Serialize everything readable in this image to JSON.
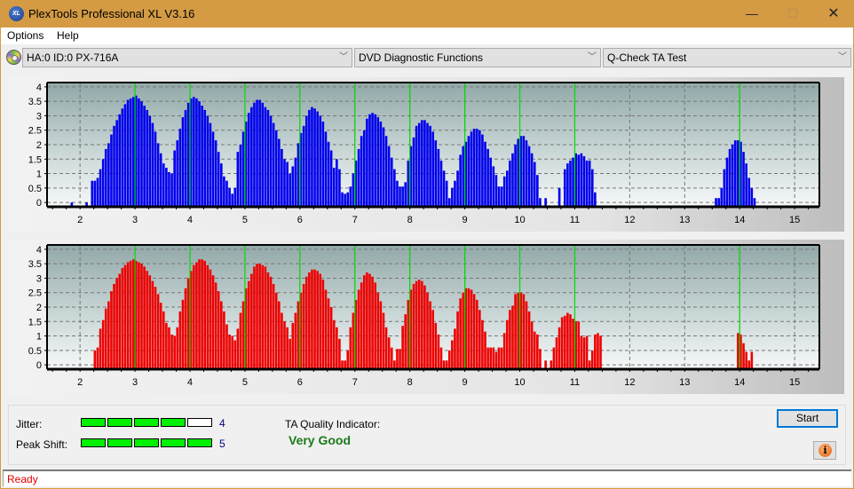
{
  "window": {
    "title": "PlexTools Professional XL V3.16",
    "app_icon_text": "XL",
    "minimize": "—",
    "maximize": "☐",
    "close": "✕"
  },
  "menu": [
    "Options",
    "Help"
  ],
  "toolbar": {
    "drive": "HA:0 ID:0  PX-716A",
    "function": "DVD Diagnostic Functions",
    "test": "Q-Check TA Test",
    "arrow": "﹀"
  },
  "colors": {
    "top_bars": "#0000ee",
    "bottom_bars": "#ee0000",
    "marker_lines": "#00dd00",
    "meter_on": "#00f000",
    "quality_text": "#1a7a1a",
    "status_text": "#e00000"
  },
  "chart_data": [
    {
      "type": "bar",
      "name": "TA distribution (blue)",
      "xlim": [
        1.4,
        15.45
      ],
      "ylim": [
        -0.15,
        4.15
      ],
      "xticks": [
        2,
        3,
        4,
        5,
        6,
        7,
        8,
        9,
        10,
        11,
        12,
        13,
        14,
        15
      ],
      "yticks": [
        0,
        0.5,
        1,
        1.5,
        2,
        2.5,
        3,
        3.5,
        4
      ],
      "ytick_labels": [
        "0",
        "0.5",
        "1",
        "1.5",
        "2",
        "2.5",
        "3",
        "3.5",
        "4"
      ],
      "markers": [
        3,
        4,
        5,
        6,
        7,
        8,
        9,
        10,
        11,
        14
      ],
      "grid": true,
      "bars": {
        "x": [
          1.85,
          2.12,
          2.22,
          2.27,
          2.32,
          2.37,
          2.42,
          2.47,
          2.52,
          2.57,
          2.62,
          2.67,
          2.72,
          2.77,
          2.82,
          2.87,
          2.92,
          2.97,
          3.02,
          3.07,
          3.12,
          3.17,
          3.22,
          3.27,
          3.32,
          3.37,
          3.42,
          3.47,
          3.52,
          3.57,
          3.62,
          3.67,
          3.72,
          3.77,
          3.82,
          3.87,
          3.92,
          3.97,
          4.02,
          4.07,
          4.12,
          4.17,
          4.22,
          4.27,
          4.32,
          4.37,
          4.42,
          4.47,
          4.52,
          4.57,
          4.62,
          4.67,
          4.72,
          4.77,
          4.82,
          4.87,
          4.92,
          4.97,
          5.02,
          5.07,
          5.12,
          5.17,
          5.22,
          5.27,
          5.32,
          5.37,
          5.42,
          5.47,
          5.52,
          5.57,
          5.62,
          5.67,
          5.72,
          5.77,
          5.82,
          5.87,
          5.92,
          5.97,
          6.02,
          6.07,
          6.12,
          6.17,
          6.22,
          6.27,
          6.32,
          6.37,
          6.42,
          6.47,
          6.52,
          6.57,
          6.62,
          6.67,
          6.72,
          6.77,
          6.82,
          6.87,
          6.92,
          6.97,
          7.02,
          7.07,
          7.12,
          7.17,
          7.22,
          7.27,
          7.32,
          7.37,
          7.42,
          7.47,
          7.52,
          7.57,
          7.62,
          7.67,
          7.72,
          7.77,
          7.82,
          7.87,
          7.92,
          7.97,
          8.02,
          8.07,
          8.12,
          8.17,
          8.22,
          8.27,
          8.32,
          8.37,
          8.42,
          8.47,
          8.52,
          8.57,
          8.62,
          8.67,
          8.72,
          8.77,
          8.82,
          8.87,
          8.92,
          8.97,
          9.02,
          9.07,
          9.12,
          9.17,
          9.22,
          9.27,
          9.32,
          9.37,
          9.42,
          9.47,
          9.52,
          9.57,
          9.62,
          9.67,
          9.72,
          9.77,
          9.82,
          9.87,
          9.92,
          9.97,
          10.02,
          10.07,
          10.12,
          10.17,
          10.22,
          10.27,
          10.32,
          10.37,
          10.47,
          10.72,
          10.82,
          10.87,
          10.92,
          10.97,
          11.02,
          11.07,
          11.12,
          11.17,
          11.22,
          11.27,
          11.32,
          11.37,
          13.57,
          13.62,
          13.67,
          13.72,
          13.77,
          13.82,
          13.87,
          13.92,
          13.97,
          14.02,
          14.07,
          14.12,
          14.17,
          14.22,
          14.27
        ],
        "values": [
          0,
          0,
          0.75,
          0.75,
          0.85,
          1.15,
          1.5,
          1.85,
          2.05,
          2.35,
          2.65,
          2.85,
          3.05,
          3.25,
          3.4,
          3.55,
          3.6,
          3.65,
          3.7,
          3.6,
          3.5,
          3.35,
          3.2,
          3.0,
          2.75,
          2.45,
          2.05,
          1.7,
          1.35,
          1.2,
          1.05,
          1.0,
          1.8,
          2.15,
          2.55,
          2.95,
          3.2,
          3.45,
          3.6,
          3.65,
          3.6,
          3.5,
          3.35,
          3.2,
          3.0,
          2.75,
          2.45,
          2.15,
          1.75,
          1.35,
          0.9,
          0.75,
          0.5,
          0.3,
          0.5,
          1.75,
          2.0,
          2.45,
          2.8,
          3.1,
          3.3,
          3.45,
          3.55,
          3.55,
          3.45,
          3.3,
          3.2,
          3.0,
          2.75,
          2.5,
          2.2,
          1.85,
          1.5,
          1.4,
          1.0,
          1.25,
          1.55,
          2.05,
          2.4,
          2.65,
          3.0,
          3.2,
          3.3,
          3.25,
          3.15,
          3.0,
          2.8,
          2.45,
          2.1,
          1.8,
          1.2,
          1.5,
          1.15,
          0.35,
          0.3,
          0.35,
          0.55,
          1.0,
          1.45,
          1.85,
          2.3,
          2.5,
          2.9,
          3.05,
          3.1,
          3.05,
          2.95,
          2.8,
          2.6,
          2.3,
          1.95,
          1.55,
          1.15,
          0.75,
          0.55,
          0.55,
          0.7,
          1.45,
          1.95,
          2.25,
          2.65,
          2.75,
          2.85,
          2.85,
          2.75,
          2.65,
          2.45,
          2.15,
          1.85,
          1.45,
          1.1,
          0.75,
          0.15,
          0.5,
          0.75,
          1.1,
          1.65,
          1.95,
          2.1,
          2.3,
          2.45,
          2.55,
          2.55,
          2.5,
          2.35,
          2.1,
          1.85,
          1.55,
          1.25,
          0.95,
          0.55,
          0.55,
          0.9,
          1.1,
          1.45,
          1.7,
          2.0,
          2.2,
          2.3,
          2.3,
          2.15,
          1.95,
          1.7,
          1.4,
          0.95,
          0.15,
          0.15,
          0.5,
          1.15,
          1.35,
          1.45,
          1.55,
          1.7,
          1.65,
          1.7,
          1.6,
          1.45,
          1.45,
          1.15,
          0.35,
          0.15,
          0.15,
          0.5,
          1.15,
          1.55,
          1.85,
          2.0,
          2.15,
          2.15,
          2.1,
          1.75,
          1.35,
          0.85,
          0.5,
          0.15
        ],
        "color": "#0000ee"
      }
    },
    {
      "type": "bar",
      "name": "TA distribution (red)",
      "xlim": [
        1.4,
        15.45
      ],
      "ylim": [
        -0.15,
        4.15
      ],
      "xticks": [
        2,
        3,
        4,
        5,
        6,
        7,
        8,
        9,
        10,
        11,
        12,
        13,
        14,
        15
      ],
      "yticks": [
        0,
        0.5,
        1,
        1.5,
        2,
        2.5,
        3,
        3.5,
        4
      ],
      "ytick_labels": [
        "0",
        "0.5",
        "1",
        "1.5",
        "2",
        "2.5",
        "3",
        "3.5",
        "4"
      ],
      "markers": [
        3,
        4,
        5,
        6,
        7,
        8,
        9,
        10,
        11,
        14
      ],
      "grid": true,
      "bars": {
        "x": [
          2.27,
          2.32,
          2.37,
          2.42,
          2.47,
          2.52,
          2.57,
          2.62,
          2.67,
          2.72,
          2.77,
          2.82,
          2.87,
          2.92,
          2.97,
          3.02,
          3.07,
          3.12,
          3.17,
          3.22,
          3.27,
          3.32,
          3.37,
          3.42,
          3.47,
          3.52,
          3.57,
          3.62,
          3.67,
          3.72,
          3.77,
          3.82,
          3.87,
          3.92,
          3.97,
          4.02,
          4.07,
          4.12,
          4.17,
          4.22,
          4.27,
          4.32,
          4.37,
          4.42,
          4.47,
          4.52,
          4.57,
          4.62,
          4.67,
          4.72,
          4.77,
          4.82,
          4.87,
          4.92,
          4.97,
          5.02,
          5.07,
          5.12,
          5.17,
          5.22,
          5.27,
          5.32,
          5.37,
          5.42,
          5.47,
          5.52,
          5.57,
          5.62,
          5.67,
          5.72,
          5.77,
          5.82,
          5.87,
          5.92,
          5.97,
          6.02,
          6.07,
          6.12,
          6.17,
          6.22,
          6.27,
          6.32,
          6.37,
          6.42,
          6.47,
          6.52,
          6.57,
          6.62,
          6.67,
          6.72,
          6.77,
          6.82,
          6.87,
          6.92,
          6.97,
          7.02,
          7.07,
          7.12,
          7.17,
          7.22,
          7.27,
          7.32,
          7.37,
          7.42,
          7.47,
          7.52,
          7.57,
          7.62,
          7.67,
          7.72,
          7.77,
          7.82,
          7.87,
          7.92,
          7.97,
          8.02,
          8.07,
          8.12,
          8.17,
          8.22,
          8.27,
          8.32,
          8.37,
          8.42,
          8.47,
          8.52,
          8.57,
          8.62,
          8.67,
          8.72,
          8.77,
          8.82,
          8.87,
          8.92,
          8.97,
          9.02,
          9.07,
          9.12,
          9.17,
          9.22,
          9.27,
          9.32,
          9.37,
          9.42,
          9.47,
          9.52,
          9.57,
          9.62,
          9.67,
          9.72,
          9.77,
          9.82,
          9.87,
          9.92,
          9.97,
          10.02,
          10.07,
          10.12,
          10.17,
          10.22,
          10.27,
          10.32,
          10.37,
          10.47,
          10.57,
          10.62,
          10.67,
          10.72,
          10.77,
          10.82,
          10.87,
          10.92,
          10.97,
          11.02,
          11.07,
          11.12,
          11.17,
          11.22,
          11.27,
          11.32,
          11.37,
          11.42,
          11.47,
          13.97,
          14.02,
          14.07,
          14.12,
          14.17,
          14.22,
          14.27,
          14.32,
          14.37,
          14.42,
          14.47
        ],
        "values": [
          0.5,
          0.6,
          1.25,
          1.55,
          1.95,
          2.2,
          2.55,
          2.8,
          3.0,
          3.15,
          3.35,
          3.45,
          3.55,
          3.6,
          3.65,
          3.6,
          3.55,
          3.5,
          3.4,
          3.25,
          3.1,
          2.9,
          2.7,
          2.45,
          2.15,
          1.85,
          1.45,
          1.3,
          1.05,
          1.0,
          1.3,
          1.85,
          2.25,
          2.65,
          3.0,
          3.25,
          3.45,
          3.55,
          3.65,
          3.65,
          3.6,
          3.45,
          3.3,
          3.1,
          2.85,
          2.55,
          2.2,
          1.85,
          1.4,
          1.05,
          1.0,
          0.85,
          1.25,
          1.8,
          2.2,
          2.65,
          2.9,
          3.15,
          3.4,
          3.5,
          3.5,
          3.45,
          3.4,
          3.2,
          3.05,
          2.8,
          2.5,
          2.2,
          1.8,
          1.5,
          1.3,
          0.9,
          1.45,
          1.8,
          2.2,
          2.5,
          2.8,
          3.05,
          3.2,
          3.3,
          3.3,
          3.25,
          3.15,
          2.95,
          2.6,
          2.3,
          2.0,
          1.55,
          1.3,
          0.9,
          0.15,
          0.15,
          0.5,
          1.3,
          1.8,
          2.25,
          2.6,
          2.85,
          3.1,
          3.2,
          3.15,
          3.05,
          2.85,
          2.5,
          2.2,
          1.8,
          1.3,
          0.95,
          0.6,
          0.15,
          0.55,
          0.55,
          1.35,
          1.75,
          2.25,
          2.6,
          2.8,
          2.9,
          2.95,
          2.9,
          2.75,
          2.5,
          2.2,
          1.9,
          1.45,
          1.05,
          0.6,
          0.15,
          0.15,
          0.5,
          0.85,
          1.25,
          1.85,
          2.3,
          2.5,
          2.65,
          2.65,
          2.6,
          2.45,
          2.25,
          1.9,
          1.55,
          1.15,
          0.6,
          0.6,
          0.6,
          0.45,
          0.6,
          0.6,
          1.1,
          1.55,
          1.9,
          2.05,
          2.45,
          2.5,
          2.5,
          2.45,
          2.2,
          1.85,
          1.5,
          1.15,
          1.05,
          0.55,
          0.15,
          0.15,
          0.6,
          0.95,
          1.3,
          1.65,
          1.7,
          1.8,
          1.75,
          1.6,
          1.5,
          1.5,
          1.0,
          0.95,
          1.0,
          0.15,
          0.5,
          1.05,
          1.1,
          1.0,
          1.1,
          1.05,
          0.75,
          0.45,
          0.15,
          0.45
        ],
        "color": "#ee0000"
      }
    }
  ],
  "metrics": {
    "jitter": {
      "label": "Jitter:",
      "value": 4,
      "max": 5
    },
    "peak_shift": {
      "label": "Peak Shift:",
      "value": 5,
      "max": 5
    }
  },
  "quality": {
    "label": "TA Quality Indicator:",
    "value": "Very Good"
  },
  "buttons": {
    "start": "Start",
    "info": "i"
  },
  "status": "Ready"
}
